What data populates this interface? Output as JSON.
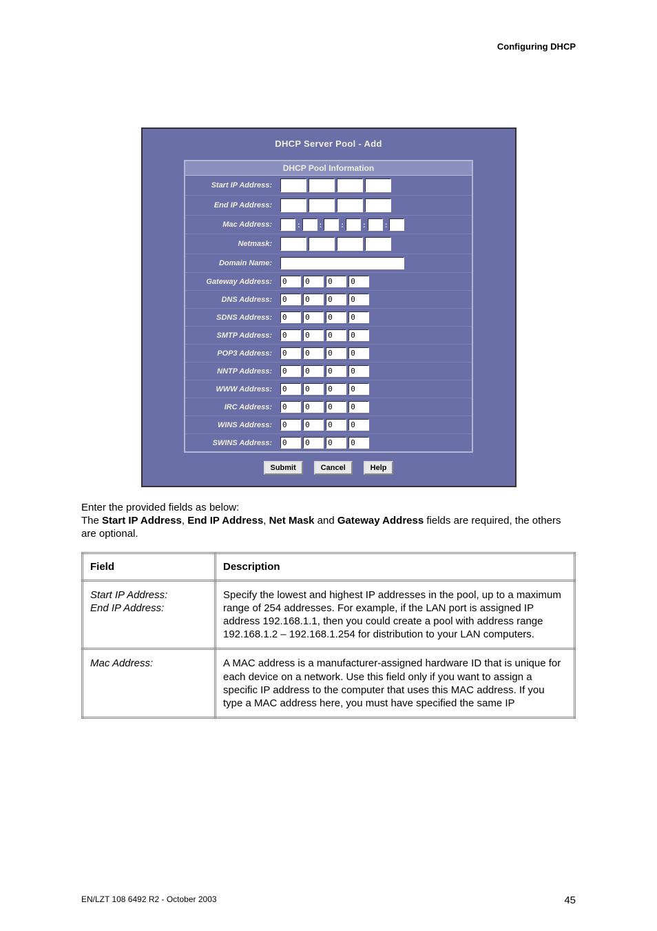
{
  "header": "Configuring DHCP",
  "panel": {
    "title": "DHCP Server Pool - Add",
    "section_header": "DHCP Pool Information",
    "default_octet": "0",
    "rows": {
      "start_ip": {
        "label": "Start IP Address:"
      },
      "end_ip": {
        "label": "End IP Address:"
      },
      "mac": {
        "label": "Mac Address:"
      },
      "netmask": {
        "label": "Netmask:"
      },
      "domain": {
        "label": "Domain Name:"
      },
      "gateway": {
        "label": "Gateway Address:"
      },
      "dns": {
        "label": "DNS Address:"
      },
      "sdns": {
        "label": "SDNS Address:"
      },
      "smtp": {
        "label": "SMTP Address:"
      },
      "pop3": {
        "label": "POP3 Address:"
      },
      "nntp": {
        "label": "NNTP Address:"
      },
      "www": {
        "label": "WWW Address:"
      },
      "irc": {
        "label": "IRC Address:"
      },
      "wins": {
        "label": "WINS Address:"
      },
      "swins": {
        "label": "SWINS Address:"
      }
    },
    "buttons": {
      "submit": "Submit",
      "cancel": "Cancel",
      "help": "Help"
    }
  },
  "body": {
    "line1": "Enter the provided fields as below:",
    "line2_pre": "The ",
    "b1": "Start IP Address",
    "sep1": ", ",
    "b2": "End IP Address",
    "sep2": ", ",
    "b3": "Net Mask",
    "sep3": " and ",
    "b4": "Gateway Address",
    "line2_post": " fields are required, the others are optional."
  },
  "table": {
    "h1": "Field",
    "h2": "Description",
    "rows": [
      {
        "field": "Start IP Address:\nEnd IP Address:",
        "desc": "Specify the lowest and highest IP addresses in the pool, up to a maximum range of 254 addresses. For example, if the LAN port is assigned IP address 192.168.1.1, then you could create a pool with address range 192.168.1.2 – 192.168.1.254 for distribution to your LAN computers."
      },
      {
        "field": "Mac Address:",
        "desc": "A MAC address is a manufacturer-assigned hardware ID that is unique for each device on a network. Use this field only if you want to assign a specific IP address to the computer that uses this MAC address. If you type a MAC address here, you must have specified the same IP"
      }
    ]
  },
  "footer": {
    "left": "EN/LZT 108 6492 R2 - October 2003",
    "page": "45"
  }
}
